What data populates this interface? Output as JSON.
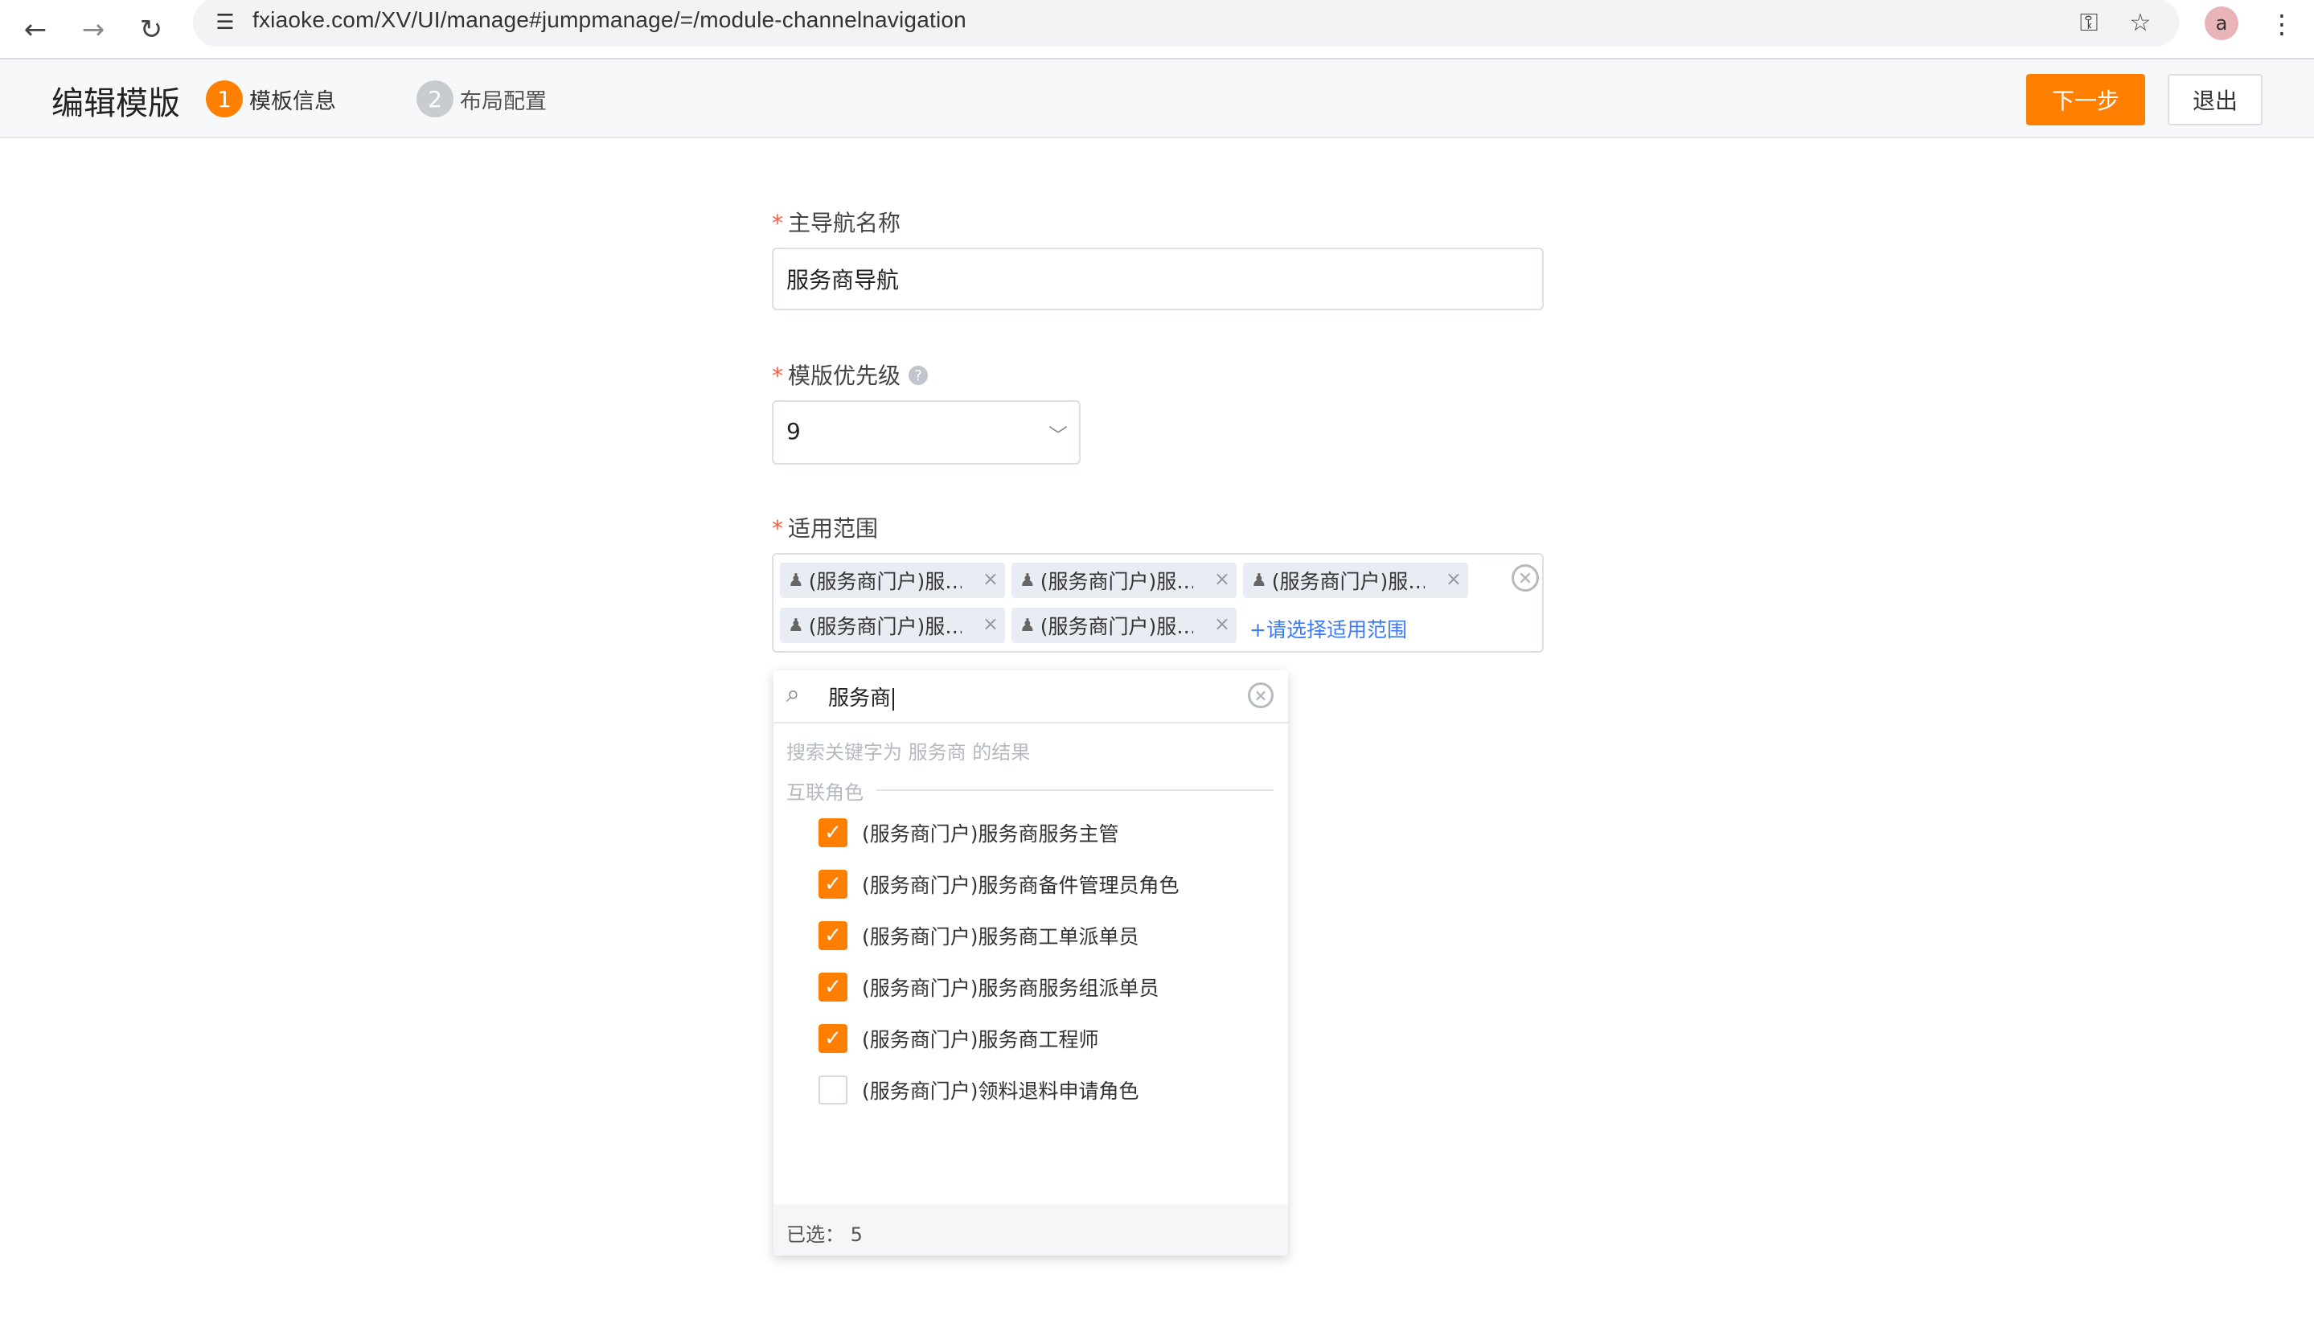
{
  "browser": {
    "url": "fxiaoke.com/XV/UI/manage#jumpmanage/=/module-channelnavigation",
    "back_icon": "←",
    "forward_icon": "→",
    "reload_icon": "↻",
    "site_info_icon": "☰",
    "key_icon": "⚿",
    "star_icon": "☆",
    "avatar_glyph": "a",
    "menu_icon": "⋮"
  },
  "header": {
    "title": "编辑模版",
    "steps": [
      {
        "num": "1",
        "label": "模板信息"
      },
      {
        "num": "2",
        "label": "布局配置"
      }
    ],
    "next_button": "下一步",
    "exit_button": "退出"
  },
  "form": {
    "name_field": {
      "required": "*",
      "label": "主导航名称",
      "value": "服务商导航"
    },
    "priority_field": {
      "required": "*",
      "label": "模版优先级",
      "help": "?",
      "value": "9",
      "chevron": "﹀"
    },
    "scope_field": {
      "required": "*",
      "label": "适用范围",
      "tags": [
        "(服务商门户)服务商服务主管",
        "(服务商门户)服务商备件管理员角色",
        "(服务商门户)服务商工单派单员",
        "(服务商门户)服务商服务组派单员",
        "(服务商门户)服务商工程师"
      ],
      "tag_display": [
        "(服务商门户)服…",
        "(服务商门户)服…",
        "(服务商门户)服…",
        "(服务商门户)服…",
        "(服务商门户)服…"
      ],
      "add_link": "+请选择适用范围",
      "clear_glyph": "×",
      "remove_glyph": "×",
      "tie_glyph": "♟"
    }
  },
  "dropdown": {
    "search_icon": "⌕",
    "search_value": "服务商",
    "hint": "搜索关键字为 服务商 的结果",
    "group_label": "互联角色",
    "check_glyph": "✓",
    "options": [
      {
        "label": "(服务商门户)服务商服务主管",
        "checked": true
      },
      {
        "label": "(服务商门户)服务商备件管理员角色",
        "checked": true
      },
      {
        "label": "(服务商门户)服务商工单派单员",
        "checked": true
      },
      {
        "label": "(服务商门户)服务商服务组派单员",
        "checked": true
      },
      {
        "label": "(服务商门户)服务商工程师",
        "checked": true
      },
      {
        "label": "(服务商门户)领料退料申请角色",
        "checked": false
      }
    ],
    "footer": "已选：  5"
  },
  "colors": {
    "accent": "#ff8000",
    "link": "#3d7af5",
    "tag_bg": "#e8ecf3"
  }
}
